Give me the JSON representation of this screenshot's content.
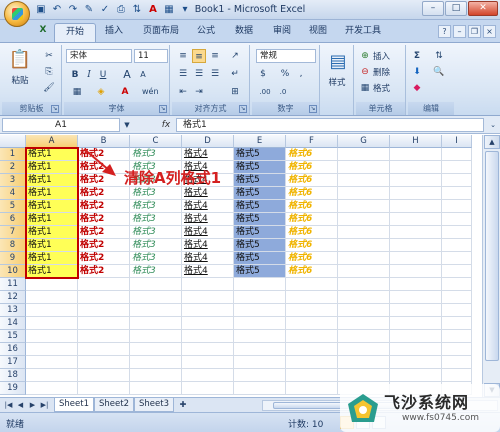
{
  "app": {
    "window_title": "Book1 - Microsoft Excel",
    "window_controls": [
      "–",
      "□",
      "✕"
    ]
  },
  "ribbon_tabs": [
    "开始",
    "插入",
    "页面布局",
    "公式",
    "数据",
    "审阅",
    "视图",
    "开发工具"
  ],
  "active_tab": "开始",
  "ribbon": {
    "clipboard": {
      "paste_label": "粘贴",
      "group_label": "剪贴板"
    },
    "font": {
      "font_name": "宋体",
      "font_size": "11",
      "group_label": "字体",
      "wen": "wén"
    },
    "alignment": {
      "group_label": "对齐方式"
    },
    "number": {
      "format": "常规",
      "percent": "%",
      "comma": ",",
      "group_label": "数字"
    },
    "styles": {
      "label": "样式"
    },
    "cells": {
      "insert": "插入",
      "delete": "删除",
      "format": "格式",
      "group_label": "单元格"
    },
    "editing": {
      "group_label": "编辑"
    }
  },
  "formula_bar": {
    "name_box": "A1",
    "fx": "fx",
    "content": "格式1"
  },
  "columns": [
    "A",
    "B",
    "C",
    "D",
    "E",
    "F",
    "G",
    "H",
    "I"
  ],
  "rows": [
    "1",
    "2",
    "3",
    "4",
    "5",
    "6",
    "7",
    "8",
    "9",
    "10",
    "11",
    "12",
    "13",
    "14",
    "15",
    "16",
    "17",
    "18",
    "19"
  ],
  "row_values": [
    "格式1",
    "格式2",
    "格式3",
    "格式4",
    "格式5",
    "格式6"
  ],
  "filled_rows": 10,
  "annotation": "清除A列格式1",
  "sheet_tabs": [
    "Sheet1",
    "Sheet2",
    "Sheet3"
  ],
  "active_sheet": "Sheet1",
  "status": {
    "ready": "就绪",
    "count": "计数: 10"
  },
  "watermark": {
    "name": "飞沙系统网",
    "url": "www.fs0745.com"
  },
  "colors": {
    "highlight_yellow": "#ffff57",
    "blue_fill": "#8eaadb",
    "red": "#c00000",
    "green": "#2e8b57",
    "gold": "#f0b400"
  }
}
